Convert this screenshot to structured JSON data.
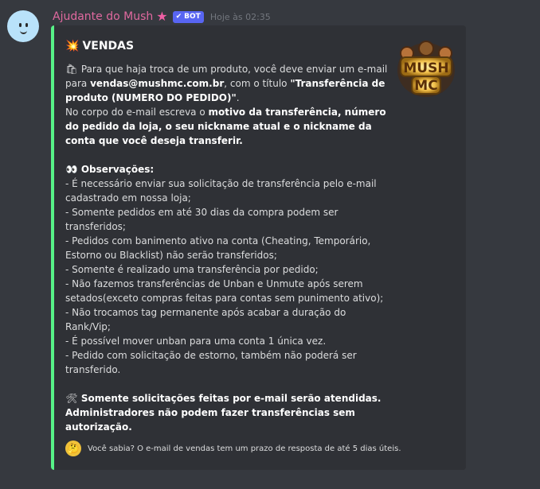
{
  "message": {
    "author": "Ajudante do Mush",
    "author_emoji": "★",
    "bot_tag": "BOT",
    "timestamp": "Hoje às 02:35"
  },
  "embed": {
    "title_emoji": "💥",
    "title": "VENDAS",
    "accent_color": "#57f287",
    "thumbnail_text": [
      "MUSH",
      "MC"
    ],
    "intro": {
      "emoji": "🛍",
      "text1": "Para que haja troca de um produto, você deve enviar um e-mail para ",
      "email": "vendas@mushmc.com.br",
      "text2": ", com o título ",
      "subject": "\"Transferência de produto (NUMERO DO PEDIDO)\"",
      "text3": "."
    },
    "body": {
      "text1": "No corpo do e-mail escreva o ",
      "bold": "motivo da transferência, número do pedido da loja, o seu nickname atual e o nickname da conta que você deseja transferir."
    },
    "observations": {
      "emoji": "👀",
      "title": "Observações:",
      "items": [
        "- É necessário enviar sua solicitação de transferência pelo e-mail cadastrado em nossa loja;",
        "- Somente pedidos em até 30 dias da compra podem ser transferidos;",
        "- Pedidos com banimento ativo na conta (Cheating, Temporário, Estorno ou Blacklist) não serão transferidos;",
        "- Somente é realizado uma transferência por pedido;",
        "- Não fazemos transferências de Unban e Unmute após serem setados(exceto compras feitas para contas sem punimento ativo);",
        "- Não trocamos tag permanente após acabar a duração do Rank/Vip;",
        "- É possível mover unban para uma conta 1 única vez.",
        "- Pedido com solicitação de estorno, também não poderá ser transferido."
      ]
    },
    "notice": {
      "emoji": "🛠",
      "text": "Somente solicitações feitas por e-mail serão atendidas. Administradores não podem fazer transferências sem autorização."
    },
    "footer": {
      "emoji": "🤔",
      "text": "Você sabia? O e-mail de vendas tem um prazo de resposta de até 5 dias úteis."
    }
  }
}
